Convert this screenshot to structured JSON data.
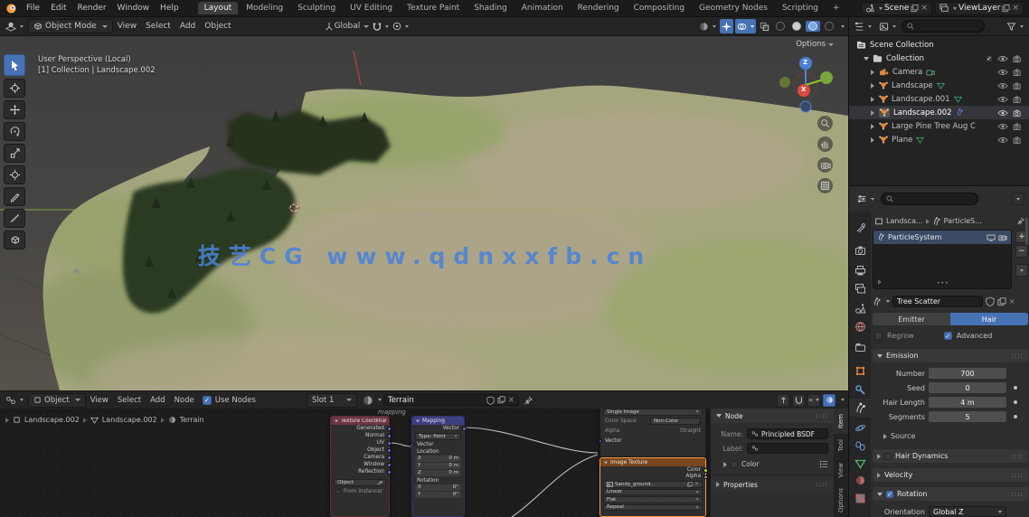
{
  "topbar": {
    "menus": [
      "File",
      "Edit",
      "Render",
      "Window",
      "Help"
    ],
    "workspaces": [
      "Layout",
      "Modeling",
      "Sculpting",
      "UV Editing",
      "Texture Paint",
      "Shading",
      "Animation",
      "Rendering",
      "Compositing",
      "Geometry Nodes",
      "Scripting"
    ],
    "new_workspace": "+",
    "scene_name": "Scene",
    "view_layer_name": "ViewLayer"
  },
  "viewport": {
    "header": {
      "mode": "Object Mode",
      "menus": [
        "View",
        "Select",
        "Add",
        "Object"
      ],
      "orientation": "Global",
      "options": "Options"
    },
    "overlay": {
      "line1": "User Perspective (Local)",
      "line2": "[1] Collection | Landscape.002"
    },
    "watermark": "技艺CG www.qdnxxfb.cn",
    "gizmo": {
      "x": "X",
      "z": "Z"
    }
  },
  "outliner": {
    "root": "Scene Collection",
    "collection": "Collection",
    "items": [
      "Camera",
      "Landscape",
      "Landscape.001",
      "Landscape.002",
      "Large Pine Tree Aug C",
      "Plane"
    ]
  },
  "properties": {
    "breadcrumb": {
      "object": "Landsca...",
      "particles": "ParticleS..."
    },
    "particle_list": {
      "item": "ParticleSystem"
    },
    "name_field": "Tree Scatter",
    "type_toggle": {
      "emitter": "Emitter",
      "hair": "Hair"
    },
    "regrow": "Regrow",
    "advanced": "Advanced",
    "emission": {
      "title": "Emission",
      "number_label": "Number",
      "number": "700",
      "seed_label": "Seed",
      "seed": "0",
      "hair_length_label": "Hair Length",
      "hair_length": "4 m",
      "segments_label": "Segments",
      "segments": "5",
      "source": "Source"
    },
    "hair_dynamics": "Hair Dynamics",
    "velocity": "Velocity",
    "rotation": "Rotation",
    "orientation_label": "Orientation Axis",
    "orientation_value": "Global Z"
  },
  "node_editor": {
    "header": {
      "type": "Object",
      "menus": [
        "View",
        "Select",
        "Add",
        "Node"
      ],
      "use_nodes": "Use Nodes",
      "slot": "Slot 1",
      "material": "Terrain"
    },
    "breadcrumb": [
      "Landscape.002",
      "Landscape.002",
      "Terrain"
    ],
    "frame_label": "mapping",
    "texture_coordinate": {
      "title": "Texture Coordinate",
      "outputs": [
        "Generated",
        "Normal",
        "UV",
        "Object",
        "Camera",
        "Window",
        "Reflection"
      ],
      "object_label": "Object",
      "from_instancer": "From Instancer"
    },
    "mapping": {
      "title": "Mapping",
      "output": "Vector",
      "type_label": "Type:",
      "type_value": "Point",
      "input": "Vector",
      "location_label": "Location",
      "x": "X",
      "y": "Y",
      "z": "Z",
      "loc_x": "0 m",
      "loc_y": "0 m",
      "loc_z": "0 m",
      "rotation_label": "Rotation",
      "rot_x": "0°",
      "rot_y": "0°"
    },
    "image_texture_top": {
      "source": "Single Image",
      "color_space_label": "Color Space",
      "color_space": "Non-Color",
      "alpha_label": "Alpha",
      "alpha": "Straight",
      "input": "Vector"
    },
    "image_texture": {
      "title": "Image Texture",
      "outputs": [
        "Color",
        "Alpha"
      ],
      "image_name": "Sandy_ground...",
      "interpolation": "Linear",
      "projection": "Flat",
      "extension": "Repeat"
    },
    "n_panel": {
      "section": "Node",
      "name_label": "Name:",
      "name_value": "Principled BSDF",
      "label_label": "Label:",
      "color": "Color",
      "properties": "Properties",
      "tabs": [
        "Item",
        "Tool",
        "View",
        "Options"
      ]
    }
  },
  "colors": {
    "accent": "#4772b3",
    "object_orange": "#e0893c",
    "watermark_blue": "#4b82d8"
  }
}
